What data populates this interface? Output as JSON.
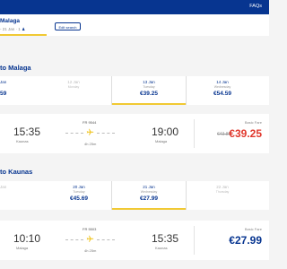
{
  "topbar": {
    "faqs_label": "FAQs"
  },
  "search": {
    "route": "Malaga",
    "date_text": "- 21 Jan",
    "passengers": "1",
    "edit_label": "Edit search"
  },
  "outbound": {
    "title": "to Malaga",
    "dates": [
      {
        "date": "Jan",
        "weekday": "",
        "price": "59"
      },
      {
        "date": "12 Jan",
        "weekday": "Monday",
        "price": ""
      },
      {
        "date": "13 Jan",
        "weekday": "Tuesday",
        "price": "€39.25"
      },
      {
        "date": "14 Jan",
        "weekday": "Wednesday",
        "price": "€54.59"
      }
    ],
    "flight": {
      "flight_number": "FR 9544",
      "dep_time": "15:35",
      "dep_city": "Kaunas",
      "arr_time": "19:00",
      "arr_city": "Malaga",
      "duration": "4h 25m",
      "fare_label": "Basic Fare",
      "old_price": "€43.86",
      "price": "€39.25"
    }
  },
  "return": {
    "title": "to Kaunas",
    "dates": [
      {
        "date": "Jan",
        "weekday": "",
        "price": ""
      },
      {
        "date": "20 Jan",
        "weekday": "Tuesday",
        "price": "€45.69"
      },
      {
        "date": "21 Jan",
        "weekday": "Wednesday",
        "price": "€27.99"
      },
      {
        "date": "22 Jan",
        "weekday": "Thursday",
        "price": ""
      }
    ],
    "flight": {
      "flight_number": "FR 5503",
      "dep_time": "10:10",
      "dep_city": "Malaga",
      "arr_time": "15:35",
      "arr_city": "Kaunas",
      "duration": "4h 25m",
      "fare_label": "Basic Fare",
      "price": "€27.99"
    }
  },
  "colors": {
    "brand_blue": "#073590",
    "accent_yellow": "#f1c933",
    "sale_red": "#e0382d"
  }
}
